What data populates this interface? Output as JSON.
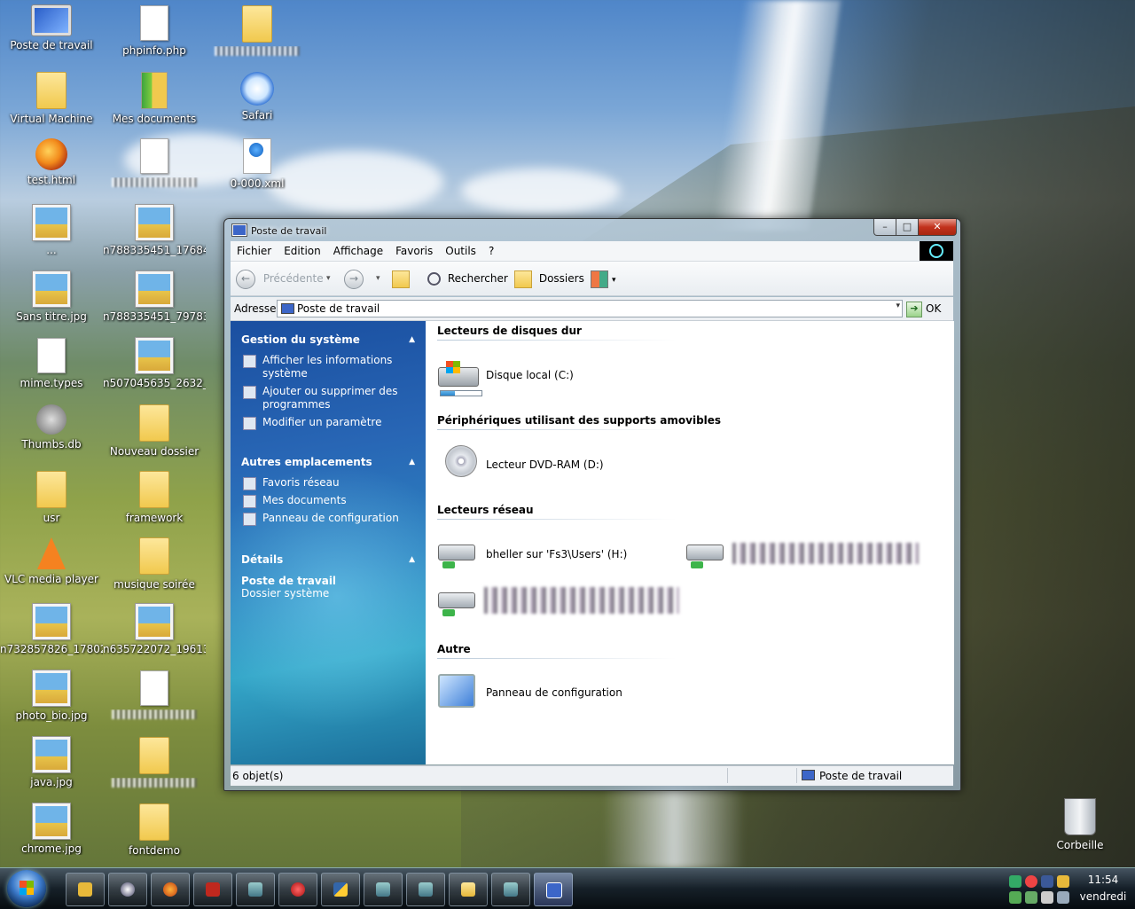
{
  "desktop": {
    "icons": [
      {
        "label": "Poste de travail",
        "icon": "computer-icon"
      },
      {
        "label": "phpinfo.php",
        "icon": "file-icon"
      },
      {
        "label": "",
        "icon": "folder-icon"
      },
      {
        "label": "Virtual Machine",
        "icon": "folder-icon"
      },
      {
        "label": "Mes documents",
        "icon": "my-documents-icon"
      },
      {
        "label": "Safari",
        "icon": "safari-icon"
      },
      {
        "label": "test.html",
        "icon": "firefox-icon"
      },
      {
        "label": "",
        "icon": "text-file-icon"
      },
      {
        "label": "0-000.xml",
        "icon": "xml-file-icon"
      },
      {
        "label": "...",
        "icon": "image-icon"
      },
      {
        "label": "n788335451_17684...",
        "icon": "image-icon"
      },
      {
        "label": "Sans titre.jpg",
        "icon": "image-icon"
      },
      {
        "label": "n788335451_79783...",
        "icon": "image-icon"
      },
      {
        "label": "mime.types",
        "icon": "file-icon"
      },
      {
        "label": "n507045635_2632_...",
        "icon": "image-icon"
      },
      {
        "label": "Thumbs.db",
        "icon": "gear-icon"
      },
      {
        "label": "Nouveau dossier",
        "icon": "folder-icon"
      },
      {
        "label": "usr",
        "icon": "folder-icon"
      },
      {
        "label": "framework",
        "icon": "folder-icon"
      },
      {
        "label": "VLC media player",
        "icon": "vlc-icon"
      },
      {
        "label": "musique soirée",
        "icon": "folder-icon"
      },
      {
        "label": "n732857826_17802...",
        "icon": "image-icon"
      },
      {
        "label": "n635722072_19613...",
        "icon": "image-icon"
      },
      {
        "label": "photo_bio.jpg",
        "icon": "image-icon"
      },
      {
        "label": "",
        "icon": "file-icon"
      },
      {
        "label": "java.jpg",
        "icon": "image-icon"
      },
      {
        "label": "",
        "icon": "folder-icon"
      },
      {
        "label": "chrome.jpg",
        "icon": "image-icon"
      },
      {
        "label": "fontdemo",
        "icon": "folder-icon"
      }
    ],
    "recycle_bin": "Corbeille"
  },
  "window": {
    "title": "Poste de travail",
    "controls": {
      "minimize": "–",
      "maximize": "□",
      "close": "✕"
    },
    "menu": [
      "Fichier",
      "Edition",
      "Affichage",
      "Favoris",
      "Outils",
      "?"
    ],
    "toolbar": {
      "back": "Précédente",
      "back_arrow": "←",
      "forward_arrow": "→",
      "dropdown": "▾",
      "search": "Rechercher",
      "folders": "Dossiers"
    },
    "address": {
      "label": "Adresse",
      "value": "Poste de travail",
      "dropdown": "▾",
      "go": "OK",
      "go_arrow": "➔"
    },
    "sidebar": {
      "chevron": "▲",
      "system_tasks": {
        "title": "Gestion du système",
        "items": [
          "Afficher les informations système",
          "Ajouter ou supprimer des programmes",
          "Modifier un paramètre"
        ]
      },
      "other_places": {
        "title": "Autres emplacements",
        "items": [
          "Favoris réseau",
          "Mes documents",
          "Panneau de configuration"
        ]
      },
      "details": {
        "title": "Détails",
        "name": "Poste de travail",
        "type": "Dossier système"
      }
    },
    "groups": {
      "hard_drives": {
        "title": "Lecteurs de disques dur",
        "items": [
          {
            "name": "Disque local (C:)",
            "used_fraction": 0.35
          }
        ]
      },
      "removable": {
        "title": "Périphériques utilisant des supports amovibles",
        "items": [
          {
            "name": "Lecteur DVD-RAM (D:)"
          }
        ]
      },
      "network": {
        "title": "Lecteurs réseau",
        "items": [
          {
            "name": "bheller sur 'Fs3\\Users' (H:)"
          }
        ]
      },
      "other": {
        "title": "Autre",
        "items": [
          {
            "name": "Panneau de configuration"
          }
        ]
      }
    },
    "status": {
      "count": "6 objet(s)",
      "location": "Poste de travail"
    }
  },
  "taskbar": {
    "clock_time": "11:54",
    "clock_day": "vendredi"
  },
  "colors": {
    "sidebar_top": "#1a4fa0",
    "sidebar_bottom": "#34a6c8",
    "close_button": "#c2321d"
  }
}
